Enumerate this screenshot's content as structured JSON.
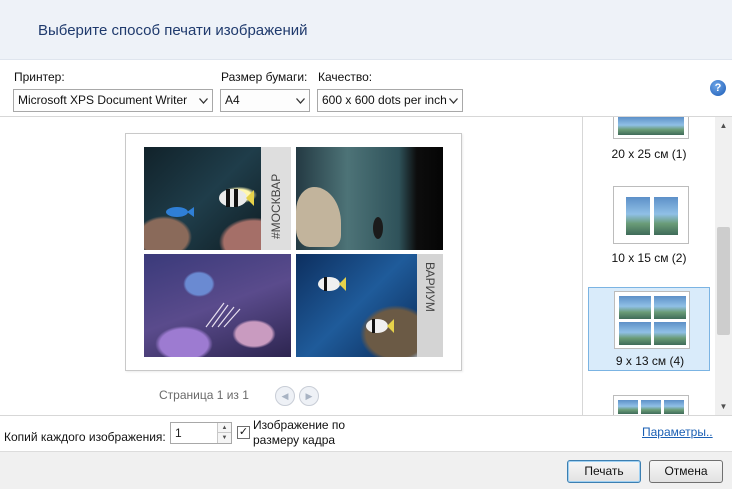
{
  "header": {
    "title": "Выберите способ печати изображений"
  },
  "toolbar": {
    "printer_label": "Принтер:",
    "printer_value": "Microsoft XPS Document Writer",
    "paper_label": "Размер бумаги:",
    "paper_value": "A4",
    "quality_label": "Качество:",
    "quality_value": "600 x 600 dots per inch",
    "help_icon": "question-mark-icon"
  },
  "preview": {
    "pager": "Страница 1 из 1",
    "photos": [
      "fish-photo-1",
      "fish-photo-2",
      "fish-photo-3",
      "fish-photo-4"
    ],
    "photo_text_1": "#МОСКВАР",
    "photo_text_4": "ВАРИУМ"
  },
  "layouts": [
    {
      "label": "20 x 25 см (1)"
    },
    {
      "label": "10 x 15 см (2)"
    },
    {
      "label": "9 x 13 см (4)",
      "selected": true
    },
    {
      "label": ""
    }
  ],
  "bottom": {
    "copies_label": "Копий каждого изображения:",
    "copies_value": "1",
    "fit_label": "Изображение по размеру кадра",
    "fit_checked": true,
    "params_link": "Параметры.."
  },
  "footer": {
    "print_label": "Печать",
    "cancel_label": "Отмена"
  },
  "colors": {
    "header_bg": "#eef2f8",
    "title": "#1f3a6d",
    "link": "#1a5fb4",
    "selection": "#d9ebfa"
  }
}
